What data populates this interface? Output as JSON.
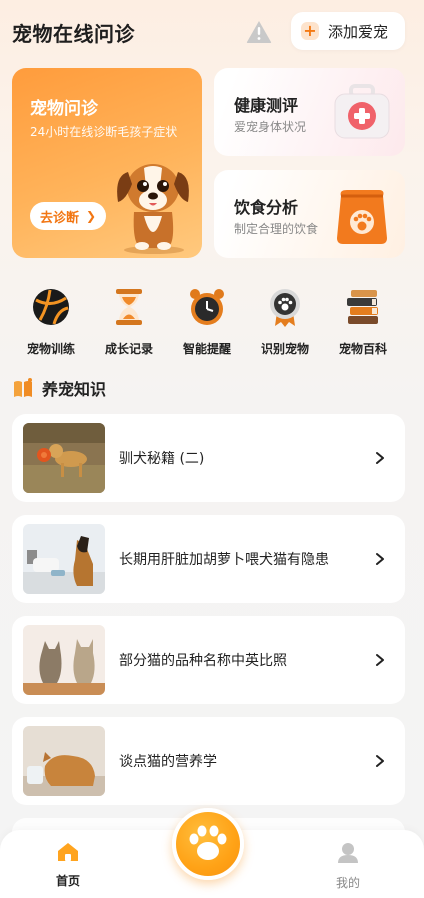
{
  "header": {
    "title": "宠物在线问诊",
    "add_pet_label": "添加爱宠",
    "alert_icon": "warning-icon"
  },
  "cards": {
    "consult": {
      "title": "宠物问诊",
      "subtitle": "24小时在线诊断毛孩子症状",
      "button": "去诊断"
    },
    "health": {
      "title": "健康测评",
      "subtitle": "爱宠身体状况"
    },
    "diet": {
      "title": "饮食分析",
      "subtitle": "制定合理的饮食"
    }
  },
  "menu": [
    {
      "label": "宠物训练",
      "icon": "ball-icon"
    },
    {
      "label": "成长记录",
      "icon": "hourglass-icon"
    },
    {
      "label": "智能提醒",
      "icon": "alarm-clock-icon"
    },
    {
      "label": "识别宠物",
      "icon": "paw-badge-icon"
    },
    {
      "label": "宠物百科",
      "icon": "books-icon"
    }
  ],
  "section": {
    "title": "养宠知识"
  },
  "articles": [
    {
      "title": "驯犬秘籍 (二)"
    },
    {
      "title": "长期用肝脏加胡萝卜喂犬猫有隐患"
    },
    {
      "title": "部分猫的品种名称中英比照"
    },
    {
      "title": "谈点猫的营养学"
    }
  ],
  "tabbar": {
    "home": "首页",
    "me": "我的"
  },
  "colors": {
    "accent": "#ff9c3c",
    "accent_dark": "#f27613"
  }
}
